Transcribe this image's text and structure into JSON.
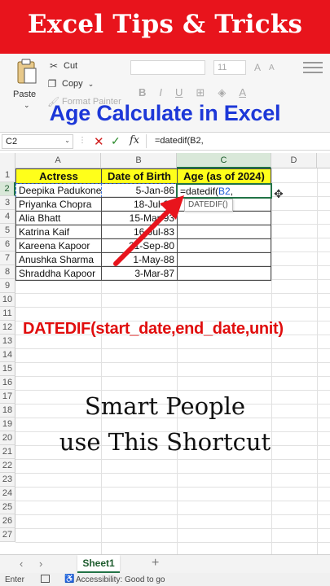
{
  "banner": {
    "title": "Excel Tips & Tricks"
  },
  "ribbon": {
    "paste_label": "Paste",
    "cut_label": "Cut",
    "copy_label": "Copy",
    "format_painter_label": "Format Painter",
    "font_size": "11"
  },
  "overlay_title": "Age Calculate in Excel",
  "formula_bar": {
    "name_box": "C2",
    "formula": "=datedif(B2,"
  },
  "columns": [
    "A",
    "B",
    "C",
    "D"
  ],
  "rows": [
    "1",
    "2",
    "3",
    "4",
    "5",
    "6",
    "7",
    "8",
    "9",
    "10",
    "11",
    "12",
    "13",
    "14",
    "15",
    "16",
    "17",
    "18",
    "19",
    "20",
    "21",
    "22",
    "23",
    "24",
    "25",
    "26",
    "27",
    "28"
  ],
  "table": {
    "headers": [
      "Actress",
      "Date of Birth",
      "Age (as of 2024)"
    ],
    "rows": [
      {
        "name": "Deepika Padukone",
        "dob": "5-Jan-86"
      },
      {
        "name": "Priyanka Chopra",
        "dob": "18-Jul-82"
      },
      {
        "name": "Alia Bhatt",
        "dob": "15-Mar-93"
      },
      {
        "name": "Katrina Kaif",
        "dob": "16-Jul-83"
      },
      {
        "name": "Kareena Kapoor",
        "dob": "21-Sep-80"
      },
      {
        "name": "Anushka Sharma",
        "dob": "1-May-88"
      },
      {
        "name": "Shraddha Kapoor",
        "dob": "3-Mar-87"
      }
    ],
    "editing_cell": {
      "prefix": "=datedif(",
      "ref": "B2",
      "suffix": ","
    }
  },
  "autocomplete": "DATEDIF()",
  "syntax_text": "DATEDIF(start_date,end_date,unit)",
  "caption": {
    "line1": "Smart People",
    "line2": "use This Shortcut"
  },
  "sheet_tab": "Sheet1",
  "status": {
    "mode": "Enter",
    "accessibility": "Accessibility: Good to go"
  },
  "colors": {
    "banner": "#e8141c",
    "overlay_title": "#1d38d8",
    "syntax": "#e00d0d",
    "header_fill": "#ffff1a",
    "accent": "#217346"
  }
}
